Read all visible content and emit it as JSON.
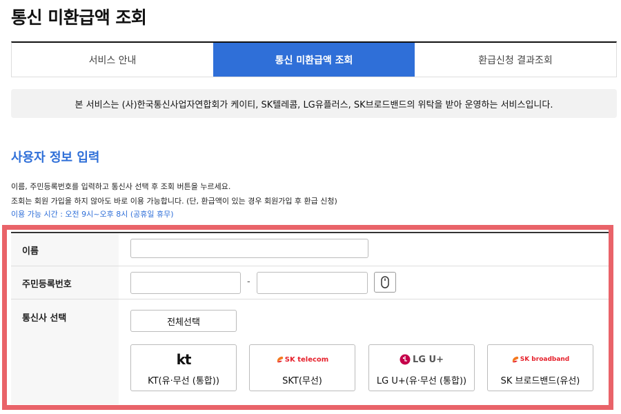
{
  "page_title": "통신 미환급액 조회",
  "tabs": [
    {
      "label": "서비스 안내",
      "active": false
    },
    {
      "label": "통신 미환급액 조회",
      "active": true
    },
    {
      "label": "환급신청 결과조회",
      "active": false
    }
  ],
  "notice": "본 서비스는 (사)한국통신사업자연합회가 케이티, SK텔레콤, LG유플러스, SK브로드밴드의 위탁을 받아 운영하는 서비스입니다.",
  "section": {
    "title": "사용자 정보 입력",
    "desc_line1": "이름, 주민등록번호를 입력하고 통신사 선택 후 조회 버튼을 누르세요.",
    "desc_line2": "조회는 회원 가입을 하지 않아도 바로 이용 가능합니다. (단, 환급액이 있는 경우 회원가입 후 환급 신청)",
    "hours": "이용 가능 시간 : 오전 9시~오후 8시 (공휴일 휴무)"
  },
  "form": {
    "name_label": "이름",
    "name_value": "",
    "rrn_label": "주민등록번호",
    "rrn_front_value": "",
    "rrn_back_value": "",
    "rrn_separator": "-",
    "keypad_icon": "mouse-icon",
    "carrier_label": "통신사 선택",
    "select_all_label": "전체선택",
    "carriers": [
      {
        "logo": "kt",
        "name": "KT(유·무선 (통합))"
      },
      {
        "logo": "SK telecom",
        "name": "SKT(무선)"
      },
      {
        "logo": "LG U+",
        "name": "LG U+(유·무선 (통합))"
      },
      {
        "logo": "SK broadband",
        "name": "SK 브로드밴드(유선)"
      }
    ]
  },
  "colors": {
    "accent_blue": "#2f6fd8",
    "highlight_red": "#e96369",
    "sk_red": "#e6212c",
    "sk_orange": "#f47920",
    "lg_magenta": "#c5004a"
  }
}
